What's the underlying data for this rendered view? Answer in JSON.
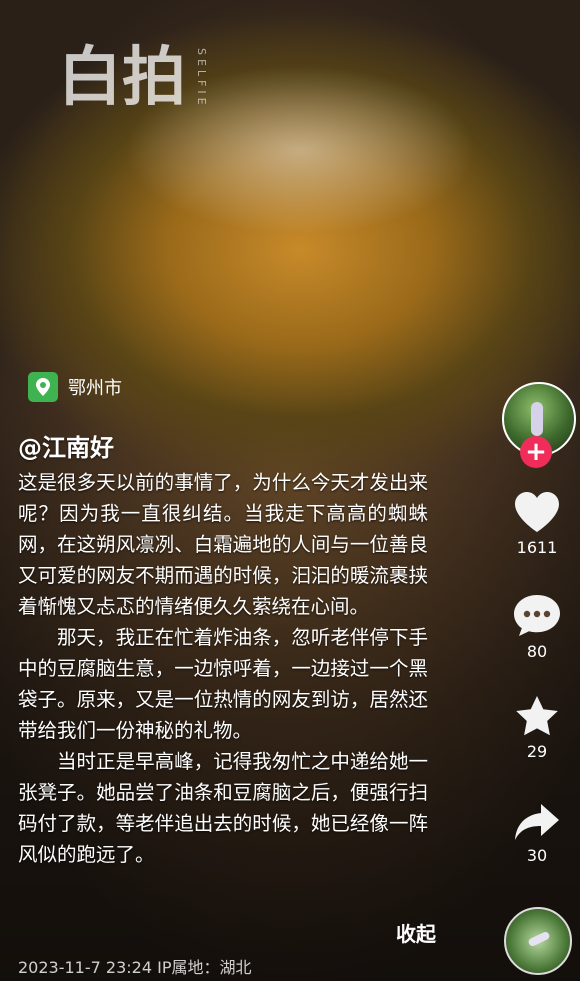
{
  "watermark": {
    "brand": "白拍",
    "sub": "SELFIE"
  },
  "location": {
    "label": "鄂州市",
    "icon": "location-pin-icon"
  },
  "post": {
    "username": "@江南好",
    "paragraphs": [
      "这是很多天以前的事情了，为什么今天才发出来呢？因为我一直很纠结。当我走下高高的蜘蛛网，在这朔风凛冽、白霜遍地的人间与一位善良又可爱的网友不期而遇的时候，汩汩的暖流裹挟着惭愧又忐忑的情绪便久久萦绕在心间。",
      "那天，我正在忙着炸油条，忽听老伴停下手中的豆腐脑生意，一边惊呼着，一边接过一个黑袋子。原来，又是一位热情的网友到访，居然还带给我们一份神秘的礼物。",
      "当时正是早高峰，记得我匆忙之中递给她一张凳子。她品尝了油条和豆腐脑之后，便强行扫码付了款，等老伴追出去的时候，她已经像一阵风似的跑远了。"
    ],
    "collapse_label": "收起",
    "timestamp": "2023-11-7 23:24",
    "ip_location": "IP属地：湖北"
  },
  "actions": {
    "follow_label": "+",
    "likes": "1611",
    "comments": "80",
    "favorites": "29",
    "shares": "30"
  },
  "colors": {
    "follow": "#f02d5a",
    "location": "#3fb34f",
    "text": "#ffffff"
  }
}
